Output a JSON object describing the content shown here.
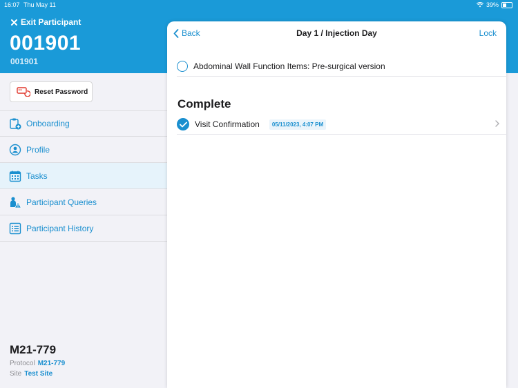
{
  "status_bar": {
    "time": "16:07",
    "date": "Thu May 11",
    "battery": "39%",
    "battery_level": 0.39
  },
  "header": {
    "exit_label": "Exit Participant",
    "participant_id": "001901",
    "participant_sub_id": "001901"
  },
  "actions": {
    "reset_password_label": "Reset Password"
  },
  "sidebar": {
    "items": [
      {
        "label": "Onboarding",
        "icon": "clipboard-plus-icon"
      },
      {
        "label": "Profile",
        "icon": "person-circle-icon"
      },
      {
        "label": "Tasks",
        "icon": "calendar-icon",
        "active": true
      },
      {
        "label": "Participant Queries",
        "icon": "person-warning-icon"
      },
      {
        "label": "Participant History",
        "icon": "list-icon"
      }
    ]
  },
  "study": {
    "title": "M21-779",
    "protocol_label": "Protocol",
    "protocol_value": "M21-779",
    "site_label": "Site",
    "site_value": "Test Site"
  },
  "panel": {
    "back_label": "Back",
    "title": "Day 1 / Injection Day",
    "lock_label": "Lock",
    "pending_tasks": [
      {
        "label": "Abdominal Wall Function Items: Pre-surgical version"
      }
    ],
    "complete_header": "Complete",
    "complete_tasks": [
      {
        "label": "Visit Confirmation",
        "timestamp": "05/11/2023, 4:07 PM"
      }
    ]
  },
  "colors": {
    "brand": "#1a9ad8",
    "accent": "#1a8fcf"
  }
}
